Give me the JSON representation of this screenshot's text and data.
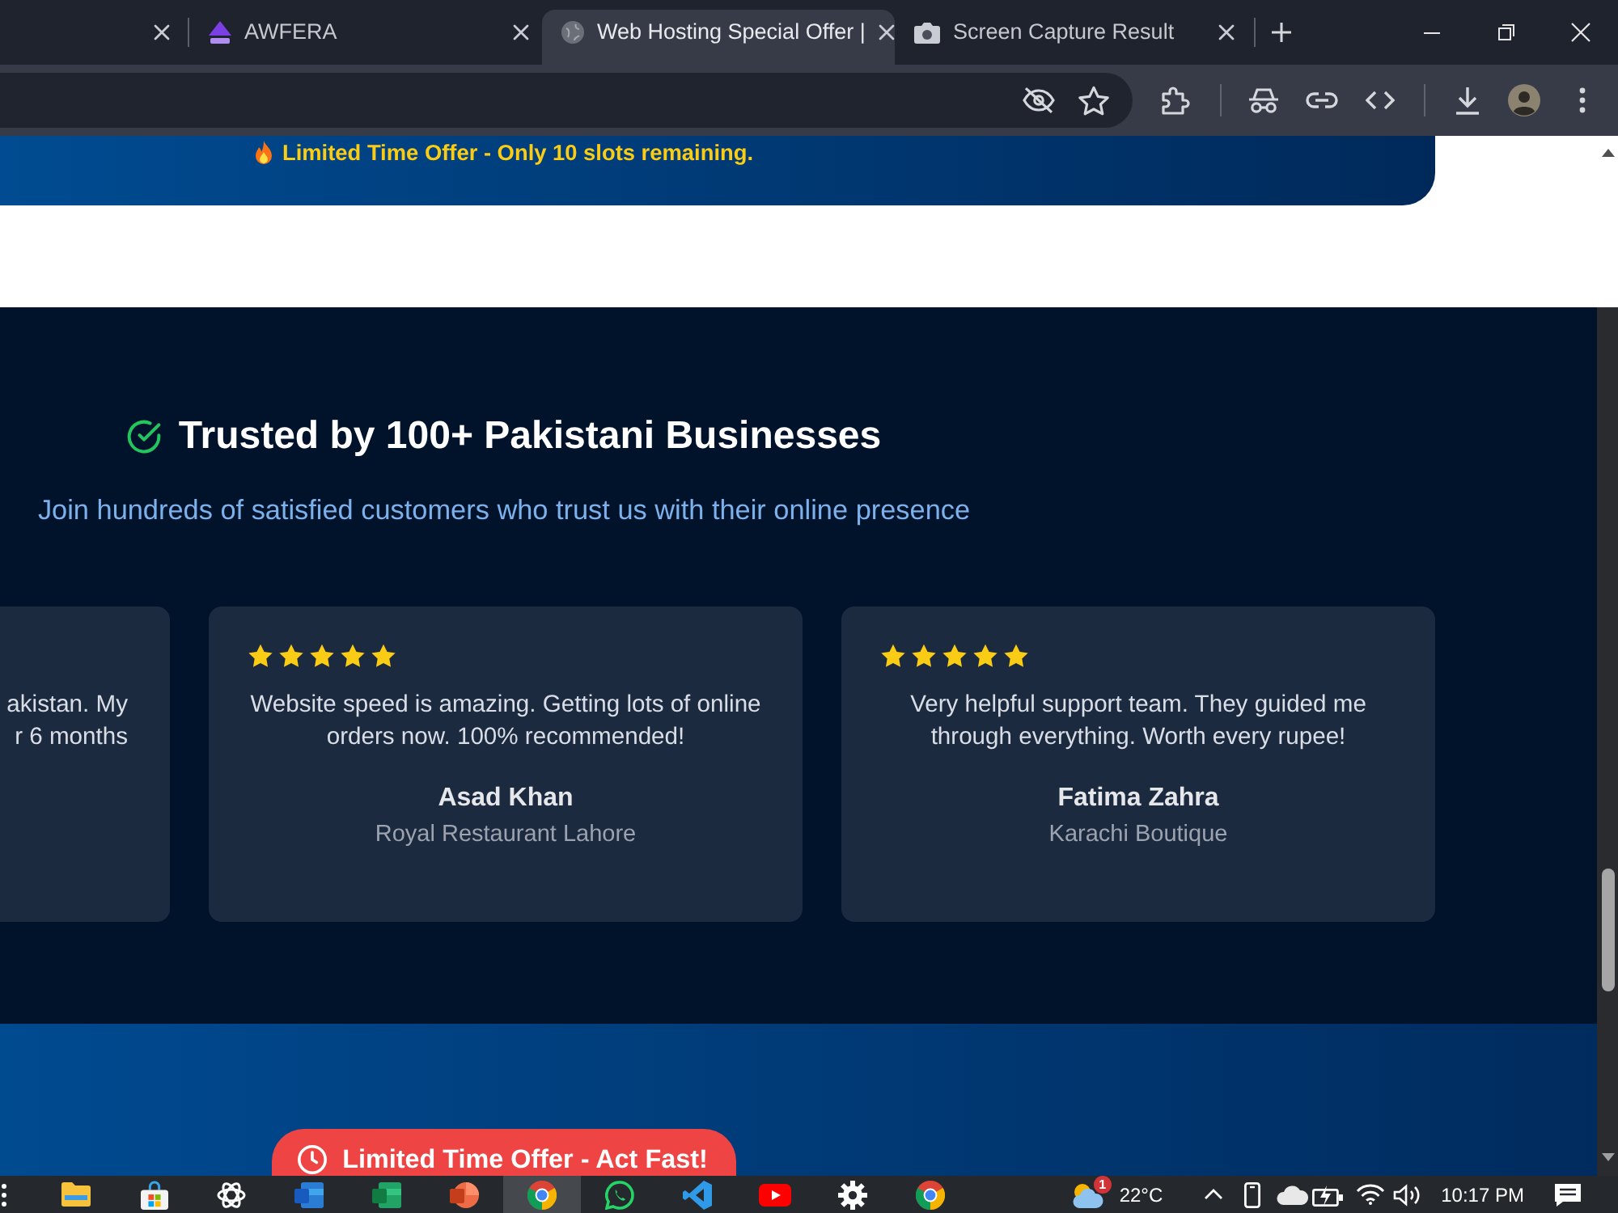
{
  "browser": {
    "tabs": [
      {
        "kind": "partial",
        "selected": false
      },
      {
        "kind": "logo",
        "title": "AWFERA",
        "selected": false
      },
      {
        "kind": "globe",
        "title": "Web Hosting Special Offer |",
        "selected": true
      },
      {
        "kind": "camera",
        "title": "Screen Capture Result",
        "selected": false
      }
    ]
  },
  "page": {
    "offer_banner": {
      "text": "Limited Time Offer - Only 10 slots remaining."
    },
    "testimonials_section": {
      "title": "Trusted by 100+ Pakistani Businesses",
      "subtitle": "Join hundreds of satisfied customers who trust us with their online presence",
      "testimonials": [
        {
          "kind": "cut",
          "lines": [
            "akistan. My",
            "r 6 months"
          ]
        },
        {
          "kind": "full",
          "stars": 5,
          "quote": "Website speed is amazing. Getting lots of online orders now. 100% recommended!",
          "name": "Asad Khan",
          "company": "Royal Restaurant Lahore"
        },
        {
          "kind": "full",
          "stars": 5,
          "quote": "Very helpful support team. They guided me through everything. Worth every rupee!",
          "name": "Fatima Zahra",
          "company": "Karachi Boutique"
        }
      ]
    },
    "cta": {
      "label": "Limited Time Offer - Act Fast!"
    }
  },
  "taskbar": {
    "apps": [
      {
        "kind": "folder",
        "active": false
      },
      {
        "kind": "store",
        "active": false
      },
      {
        "kind": "knot",
        "active": false
      },
      {
        "kind": "document",
        "active": false
      },
      {
        "kind": "spreadsheet",
        "active": false
      },
      {
        "kind": "presentation",
        "active": false
      },
      {
        "kind": "browser",
        "active": true
      },
      {
        "kind": "chat",
        "active": false
      },
      {
        "kind": "editor",
        "active": false
      },
      {
        "kind": "video",
        "active": false
      },
      {
        "kind": "settings",
        "active": false
      },
      {
        "kind": "browser",
        "active": false
      }
    ],
    "weather": {
      "temperature": "22°C",
      "badge": "1"
    },
    "clock": {
      "time": "10:17 PM"
    }
  }
}
